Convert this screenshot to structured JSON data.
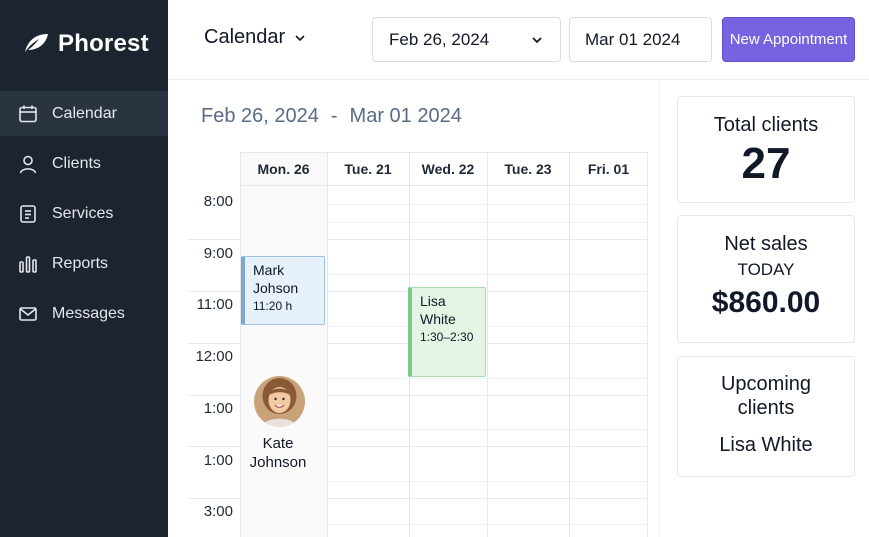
{
  "brand": {
    "name": "Phorest"
  },
  "sidebar": {
    "items": [
      {
        "label": "Calendar",
        "icon": "calendar-icon",
        "active": true
      },
      {
        "label": "Clients",
        "icon": "user-icon",
        "active": false
      },
      {
        "label": "Services",
        "icon": "list-icon",
        "active": false
      },
      {
        "label": "Reports",
        "icon": "bar-chart-icon",
        "active": false
      },
      {
        "label": "Messages",
        "icon": "mail-icon",
        "active": false
      }
    ]
  },
  "header": {
    "view_label": "Calendar",
    "date_select_value": "Feb 26, 2024",
    "date_input_value": "Mar 01 2024",
    "new_appointment_label": "New Appointment"
  },
  "calendar": {
    "range_start": "Feb 26, 2024",
    "range_sep": "-",
    "range_end": "Mar 01 2024",
    "days": [
      "Mon. 26",
      "Tue. 21",
      "Wed. 22",
      "Tue. 23",
      "Fri. 01"
    ],
    "times": [
      "8:00",
      "9:00",
      "11:00",
      "12:00",
      "1:00",
      "1:00",
      "3:00"
    ],
    "appointments": [
      {
        "name": "Mark Johson",
        "time": "11:20 h"
      },
      {
        "name": "Lisa White",
        "time": "1:30–2:30"
      }
    ],
    "avatar_client": "Kate Johnson"
  },
  "cards": {
    "total_clients_label": "Total clients",
    "total_clients_value": "27",
    "net_sales_label": "Net sales",
    "net_sales_period": "TODAY",
    "net_sales_value": "$860.00",
    "upcoming_label": "Upcoming clients",
    "upcoming_client": "Lisa White"
  },
  "colors": {
    "sidebar_bg": "#1c2430",
    "accent": "#7563e0",
    "range_text": "#5a6b85",
    "appt_blue": "#e6f1fb",
    "appt_green": "#e3f6e6"
  }
}
